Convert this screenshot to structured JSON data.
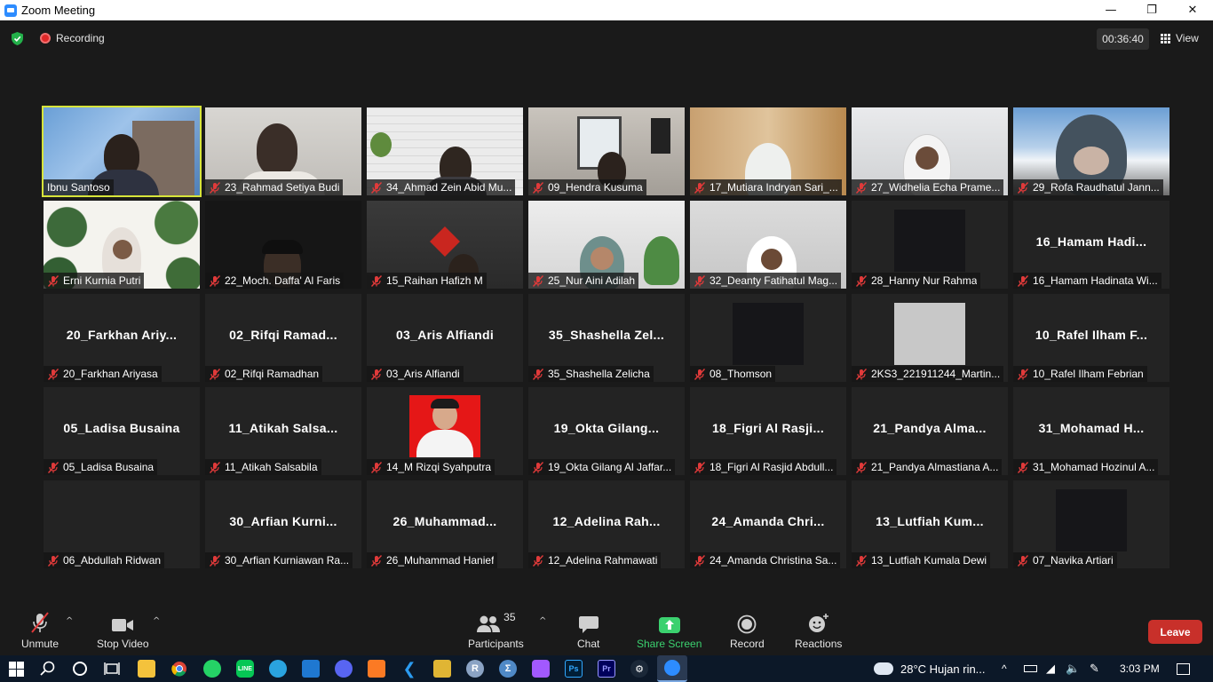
{
  "window": {
    "title": "Zoom Meeting",
    "controls": [
      "minimize",
      "restore",
      "close"
    ]
  },
  "topbar": {
    "recording_label": "Recording",
    "timer": "00:36:40",
    "view_label": "View"
  },
  "participants_tiles": [
    {
      "name": "Ibnu Santoso",
      "big": "",
      "muted": false,
      "video": "host"
    },
    {
      "name": "23_Rahmad Setiya Budi",
      "big": "",
      "muted": true,
      "video": "cam"
    },
    {
      "name": "34_Ahmad Zein Abid Mu...",
      "big": "",
      "muted": true,
      "video": "brickwall"
    },
    {
      "name": "09_Hendra Kusuma",
      "big": "",
      "muted": true,
      "video": "room"
    },
    {
      "name": "17_Mutiara Indryan Sari_...",
      "big": "",
      "muted": true,
      "video": "hijab"
    },
    {
      "name": "27_Widhelia Echa Prame...",
      "big": "",
      "muted": true,
      "video": "hijab2"
    },
    {
      "name": "29_Rofa Raudhatul Jann...",
      "big": "",
      "muted": true,
      "video": "mountain"
    },
    {
      "name": "Erni Kurnia Putri",
      "big": "",
      "muted": true,
      "video": "leaves"
    },
    {
      "name": "22_Moch. Daffa' Al Faris",
      "big": "",
      "muted": true,
      "video": "dark"
    },
    {
      "name": "15_Raihan Hafizh M",
      "big": "",
      "muted": true,
      "video": "redlogo"
    },
    {
      "name": "25_Nur Aini Adilah",
      "big": "",
      "muted": true,
      "video": "whiteroom"
    },
    {
      "name": "32_Deanty Fatihatul Mag...",
      "big": "",
      "muted": true,
      "video": "hijab3"
    },
    {
      "name": "28_Hanny Nur Rahma",
      "big": "",
      "muted": true,
      "video": "blackbox"
    },
    {
      "name": "16_Hamam Hadinata Wi...",
      "big": "16_Hamam  Hadi...",
      "muted": true,
      "video": "none"
    },
    {
      "name": "20_Farkhan Ariyasa",
      "big": "20_Farkhan  Ariy...",
      "muted": true,
      "video": "none"
    },
    {
      "name": "02_Rifqi Ramadhan",
      "big": "02_Rifqi  Ramad...",
      "muted": true,
      "video": "none"
    },
    {
      "name": "03_Aris Alfiandi",
      "big": "03_Aris  Alfiandi",
      "muted": true,
      "video": "none"
    },
    {
      "name": "35_Shashella Zelicha",
      "big": "35_Shashella  Zel...",
      "muted": true,
      "video": "none"
    },
    {
      "name": "08_Thomson",
      "big": "",
      "muted": true,
      "video": "blackbox"
    },
    {
      "name": "2KS3_221911244_Martin...",
      "big": "",
      "muted": true,
      "video": "greybox"
    },
    {
      "name": "10_Rafel Ilham Febrian",
      "big": "10_Rafel  Ilham  F...",
      "muted": true,
      "video": "none"
    },
    {
      "name": "05_Ladisa Busaina",
      "big": "05_Ladisa  Busaina",
      "muted": true,
      "video": "none"
    },
    {
      "name": "11_Atikah Salsabila",
      "big": "11_Atikah  Salsa...",
      "muted": true,
      "video": "none"
    },
    {
      "name": "14_M Rizqi Syahputra",
      "big": "",
      "muted": true,
      "video": "redphoto"
    },
    {
      "name": "19_Okta Gilang Al Jaffar...",
      "big": "19_Okta  Gilang...",
      "muted": true,
      "video": "none"
    },
    {
      "name": "18_Figri Al Rasjid Abdull...",
      "big": "18_Figri  Al  Rasji...",
      "muted": true,
      "video": "none"
    },
    {
      "name": "21_Pandya Almastiana A...",
      "big": "21_Pandya  Alma...",
      "muted": true,
      "video": "none"
    },
    {
      "name": "31_Mohamad Hozinul A...",
      "big": "31_Mohamad  H...",
      "muted": true,
      "video": "none"
    },
    {
      "name": "06_Abdullah Ridwan",
      "big": "",
      "muted": true,
      "video": "none"
    },
    {
      "name": "30_Arfian Kurniawan Ra...",
      "big": "30_Arfian  Kurni...",
      "muted": true,
      "video": "none"
    },
    {
      "name": "26_Muhammad Hanief",
      "big": "26_Muhammad...",
      "muted": true,
      "video": "none"
    },
    {
      "name": "12_Adelina Rahmawati",
      "big": "12_Adelina  Rah...",
      "muted": true,
      "video": "none"
    },
    {
      "name": "24_Amanda Christina Sa...",
      "big": "24_Amanda  Chri...",
      "muted": true,
      "video": "none"
    },
    {
      "name": "13_Lutfiah Kumala Dewi",
      "big": "13_Lutfiah  Kum...",
      "muted": true,
      "video": "none"
    },
    {
      "name": "07_Navika Artiari",
      "big": "",
      "muted": true,
      "video": "blackbox"
    }
  ],
  "toolbar": {
    "unmute": "Unmute",
    "stop_video": "Stop Video",
    "participants": "Participants",
    "participants_count": "35",
    "chat": "Chat",
    "share_screen": "Share Screen",
    "record": "Record",
    "reactions": "Reactions",
    "leave": "Leave"
  },
  "taskbar": {
    "weather": "28°C  Hujan rin...",
    "time": "3:03 PM",
    "apps": [
      "start",
      "search",
      "cortana",
      "task-view",
      "file-explorer",
      "chrome",
      "whatsapp",
      "line",
      "telegram",
      "mail",
      "discord",
      "xampp",
      "vscode",
      "3d-app",
      "r",
      "rstudio",
      "figma",
      "photoshop",
      "premiere",
      "steam",
      "zoom"
    ]
  },
  "colors": {
    "accent_green": "#3bd16f",
    "leave_red": "#c8302a",
    "active_speaker": "#d7e43a",
    "muted_icon": "#e03a3a"
  }
}
